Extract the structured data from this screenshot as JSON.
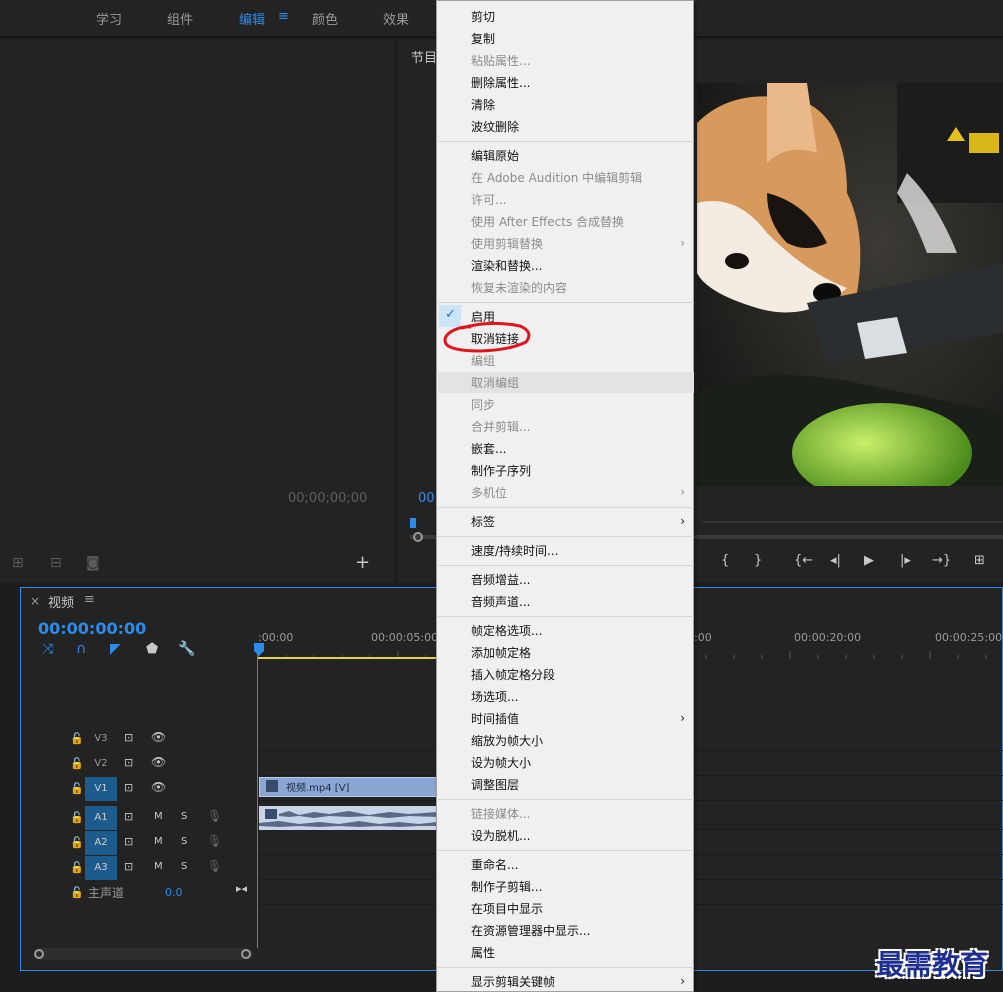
{
  "workspaces": {
    "tabs": [
      "学习",
      "组件",
      "编辑",
      "颜色",
      "效果"
    ],
    "active_index": 2,
    "menu_icon": "≡"
  },
  "source": {
    "timecode": "00;00;00;00",
    "add": "+"
  },
  "program": {
    "title": "节目",
    "timecode": "00"
  },
  "timeline": {
    "close": "×",
    "title": "视频",
    "menu": "≡",
    "timecode": "00:00:00:00",
    "ruler": [
      ":00:00",
      "00:00:05:00",
      ":00",
      "00:00:20:00",
      "00:00:25:00"
    ],
    "tracks": [
      {
        "name": "V3",
        "kind": "video",
        "on": false
      },
      {
        "name": "V2",
        "kind": "video",
        "on": false
      },
      {
        "name": "V1",
        "kind": "video",
        "on": true
      },
      {
        "name": "A1",
        "kind": "audio",
        "on": true
      },
      {
        "name": "A2",
        "kind": "audio",
        "on": true
      },
      {
        "name": "A3",
        "kind": "audio",
        "on": true
      }
    ],
    "track_m": "M",
    "track_s": "S",
    "master_label": "主声道",
    "master_value": "0.0",
    "clip_label": "视频.mp4 [V]"
  },
  "context_menu": {
    "items": [
      {
        "label": "剪切",
        "disabled": false
      },
      {
        "label": "复制",
        "disabled": false
      },
      {
        "label": "粘贴属性...",
        "disabled": true
      },
      {
        "label": "删除属性...",
        "disabled": false
      },
      {
        "label": "清除",
        "disabled": false
      },
      {
        "label": "波纹删除",
        "disabled": false
      },
      {
        "label": "编辑原始",
        "disabled": false
      },
      {
        "label": "在 Adobe Audition 中编辑剪辑",
        "disabled": true
      },
      {
        "label": "许可...",
        "disabled": true
      },
      {
        "label": "使用 After Effects 合成替换",
        "disabled": true
      },
      {
        "label": "使用剪辑替换",
        "disabled": true,
        "submenu": true
      },
      {
        "label": "渲染和替换...",
        "disabled": false
      },
      {
        "label": "恢复未渲染的内容",
        "disabled": true
      },
      {
        "label": "启用",
        "disabled": false,
        "checked": true
      },
      {
        "label": "取消链接",
        "disabled": false,
        "highlighted": true
      },
      {
        "label": "编组",
        "disabled": true
      },
      {
        "label": "取消编组",
        "disabled": true,
        "hover": true
      },
      {
        "label": "同步",
        "disabled": true
      },
      {
        "label": "合并剪辑...",
        "disabled": true
      },
      {
        "label": "嵌套...",
        "disabled": false
      },
      {
        "label": "制作子序列",
        "disabled": false
      },
      {
        "label": "多机位",
        "disabled": true,
        "submenu": true
      },
      {
        "label": "标签",
        "disabled": false,
        "submenu": true
      },
      {
        "label": "速度/持续时间...",
        "disabled": false
      },
      {
        "label": "音频增益...",
        "disabled": false
      },
      {
        "label": "音频声道...",
        "disabled": false
      },
      {
        "label": "帧定格选项...",
        "disabled": false
      },
      {
        "label": "添加帧定格",
        "disabled": false
      },
      {
        "label": "插入帧定格分段",
        "disabled": false
      },
      {
        "label": "场选项...",
        "disabled": false
      },
      {
        "label": "时间插值",
        "disabled": false,
        "submenu": true
      },
      {
        "label": "缩放为帧大小",
        "disabled": false
      },
      {
        "label": "设为帧大小",
        "disabled": false
      },
      {
        "label": "调整图层",
        "disabled": false
      },
      {
        "label": "链接媒体...",
        "disabled": true
      },
      {
        "label": "设为脱机...",
        "disabled": false
      },
      {
        "label": "重命名...",
        "disabled": false
      },
      {
        "label": "制作子剪辑...",
        "disabled": false
      },
      {
        "label": "在项目中显示",
        "disabled": false
      },
      {
        "label": "在资源管理器中显示...",
        "disabled": false
      },
      {
        "label": "属性",
        "disabled": false
      },
      {
        "label": "显示剪辑关键帧",
        "disabled": false,
        "submenu": true
      }
    ],
    "annotation_color": "#e0141e"
  },
  "watermark": "最需教育",
  "colors": {
    "accent": "#2d8ceb",
    "panel": "#232323",
    "menu_bg": "#f0f0f0"
  }
}
